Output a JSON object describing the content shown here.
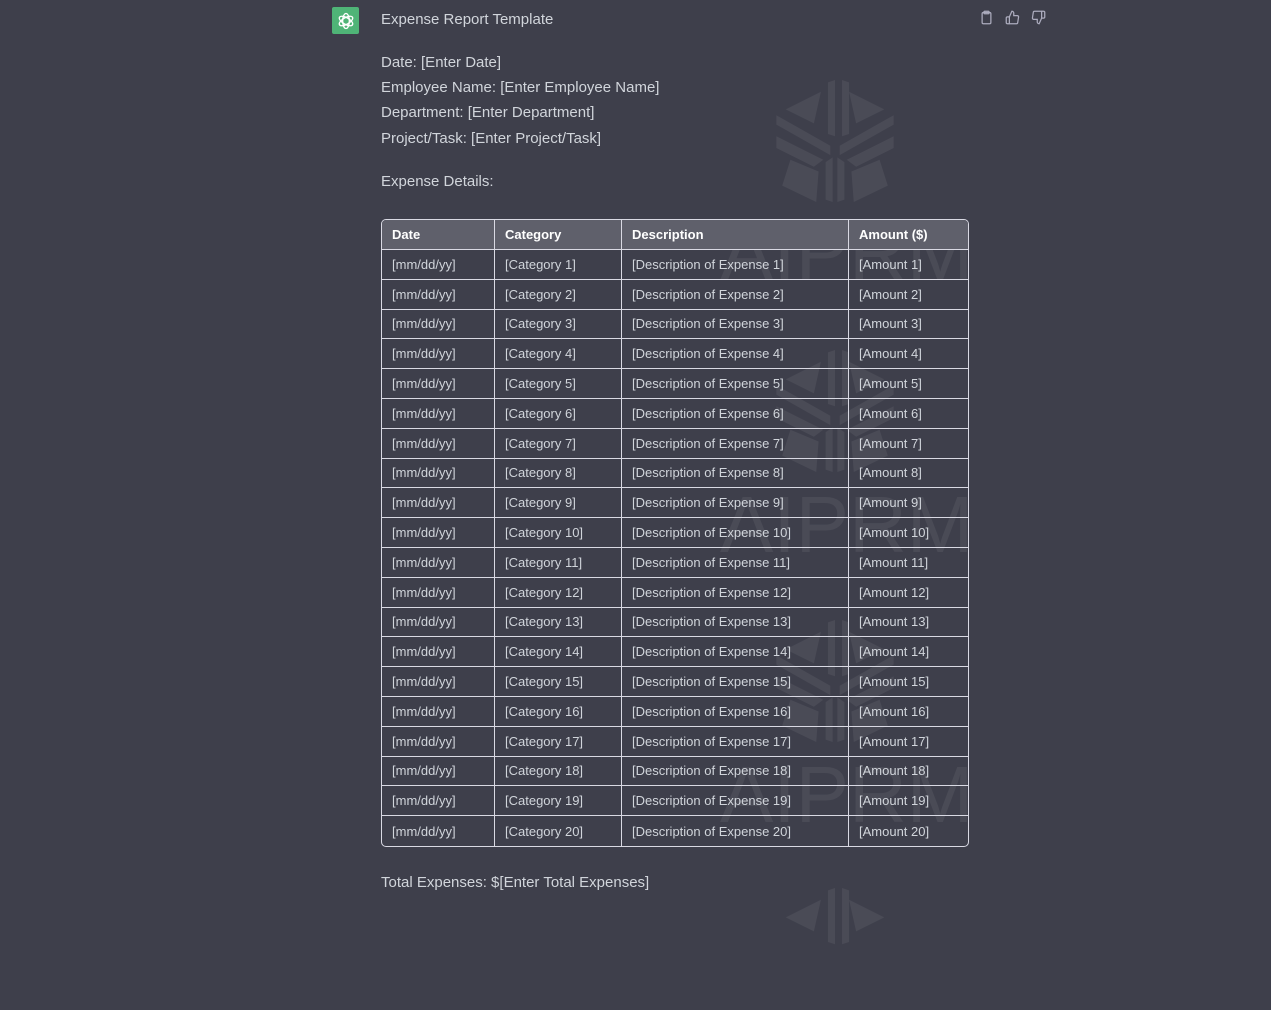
{
  "message": {
    "avatar_icon": "openai-logo-icon",
    "title": "Expense Report Template",
    "fields": [
      "Date: [Enter Date]",
      "Employee Name: [Enter Employee Name]",
      "Department: [Enter Department]",
      "Project/Task: [Enter Project/Task]"
    ],
    "section_label": "Expense Details:",
    "total": "Total Expenses: $[Enter Total Expenses]"
  },
  "actions": {
    "copy_icon": "clipboard-icon",
    "like_icon": "thumbs-up-icon",
    "dislike_icon": "thumbs-down-icon"
  },
  "watermark": "AIPRM",
  "table": {
    "headers": [
      "Date",
      "Category",
      "Description",
      "Amount ($)"
    ],
    "rows": [
      [
        "[mm/dd/yy]",
        "[Category 1]",
        "[Description of Expense 1]",
        "[Amount 1]"
      ],
      [
        "[mm/dd/yy]",
        "[Category 2]",
        "[Description of Expense 2]",
        "[Amount 2]"
      ],
      [
        "[mm/dd/yy]",
        "[Category 3]",
        "[Description of Expense 3]",
        "[Amount 3]"
      ],
      [
        "[mm/dd/yy]",
        "[Category 4]",
        "[Description of Expense 4]",
        "[Amount 4]"
      ],
      [
        "[mm/dd/yy]",
        "[Category 5]",
        "[Description of Expense 5]",
        "[Amount 5]"
      ],
      [
        "[mm/dd/yy]",
        "[Category 6]",
        "[Description of Expense 6]",
        "[Amount 6]"
      ],
      [
        "[mm/dd/yy]",
        "[Category 7]",
        "[Description of Expense 7]",
        "[Amount 7]"
      ],
      [
        "[mm/dd/yy]",
        "[Category 8]",
        "[Description of Expense 8]",
        "[Amount 8]"
      ],
      [
        "[mm/dd/yy]",
        "[Category 9]",
        "[Description of Expense 9]",
        "[Amount 9]"
      ],
      [
        "[mm/dd/yy]",
        "[Category 10]",
        "[Description of Expense 10]",
        "[Amount 10]"
      ],
      [
        "[mm/dd/yy]",
        "[Category 11]",
        "[Description of Expense 11]",
        "[Amount 11]"
      ],
      [
        "[mm/dd/yy]",
        "[Category 12]",
        "[Description of Expense 12]",
        "[Amount 12]"
      ],
      [
        "[mm/dd/yy]",
        "[Category 13]",
        "[Description of Expense 13]",
        "[Amount 13]"
      ],
      [
        "[mm/dd/yy]",
        "[Category 14]",
        "[Description of Expense 14]",
        "[Amount 14]"
      ],
      [
        "[mm/dd/yy]",
        "[Category 15]",
        "[Description of Expense 15]",
        "[Amount 15]"
      ],
      [
        "[mm/dd/yy]",
        "[Category 16]",
        "[Description of Expense 16]",
        "[Amount 16]"
      ],
      [
        "[mm/dd/yy]",
        "[Category 17]",
        "[Description of Expense 17]",
        "[Amount 17]"
      ],
      [
        "[mm/dd/yy]",
        "[Category 18]",
        "[Description of Expense 18]",
        "[Amount 18]"
      ],
      [
        "[mm/dd/yy]",
        "[Category 19]",
        "[Description of Expense 19]",
        "[Amount 19]"
      ],
      [
        "[mm/dd/yy]",
        "[Category 20]",
        "[Description of Expense 20]",
        "[Amount 20]"
      ]
    ]
  }
}
